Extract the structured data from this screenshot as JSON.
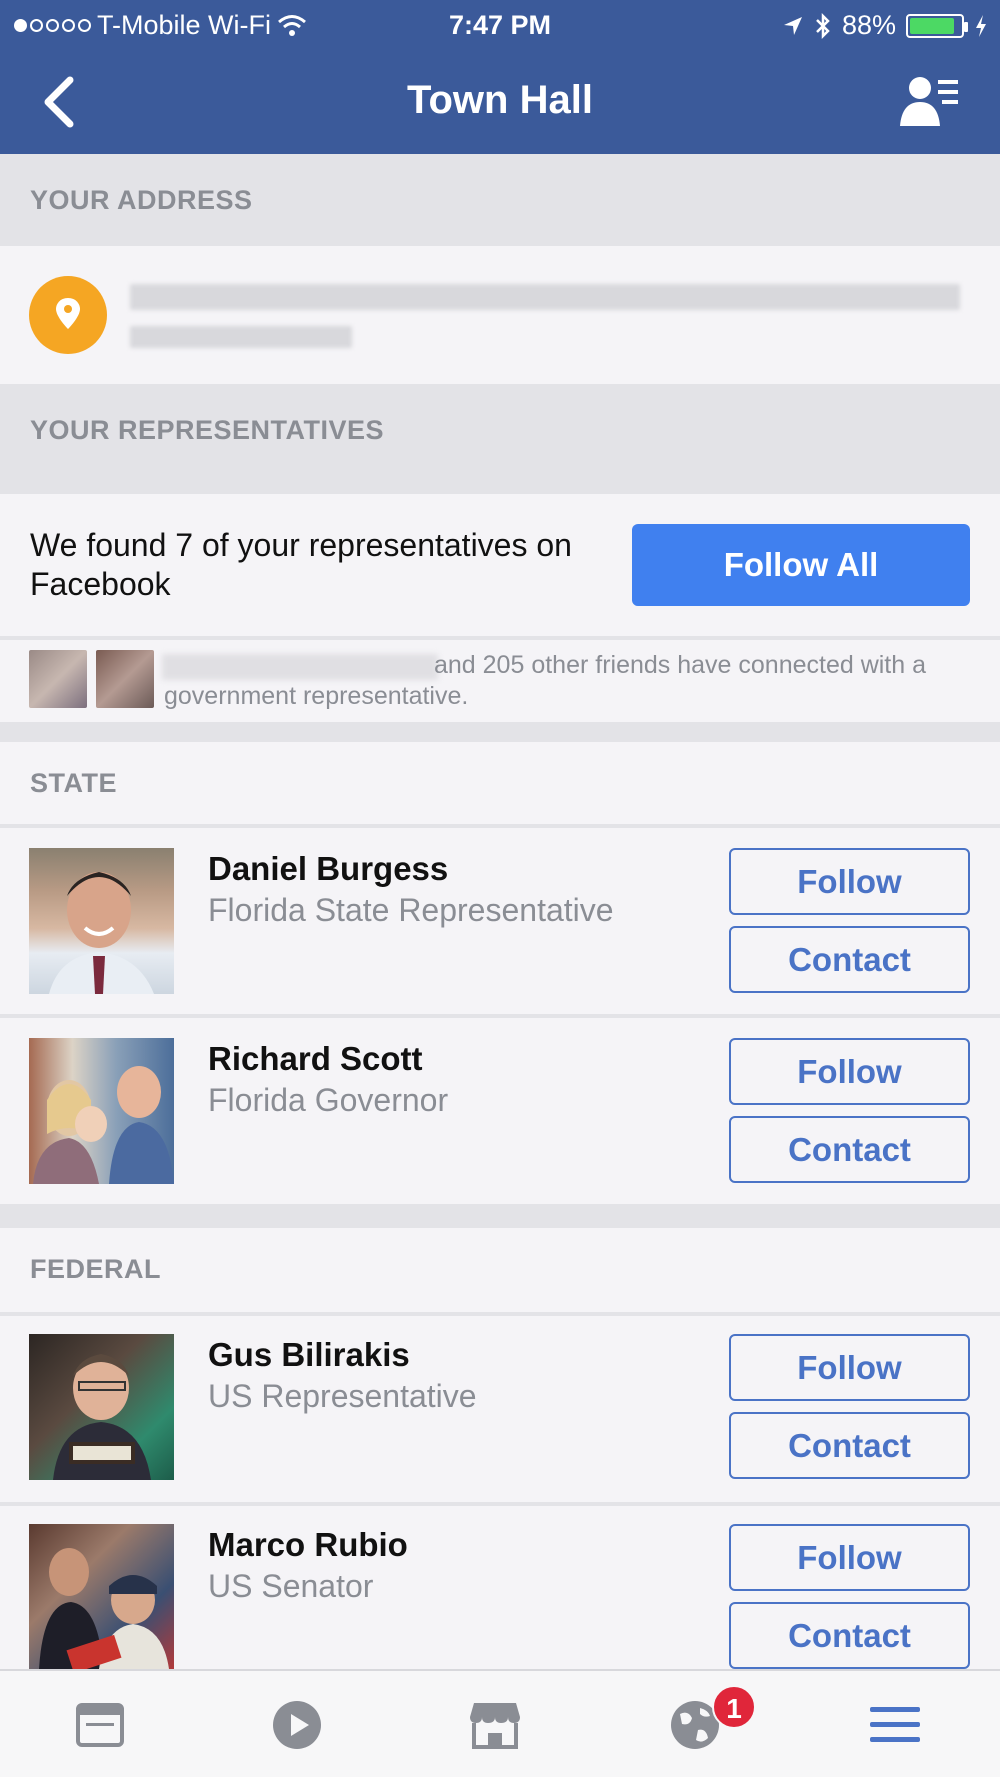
{
  "status_bar": {
    "carrier": "T-Mobile Wi-Fi",
    "time": "7:47 PM",
    "battery_percent": "88%",
    "battery_level": 0.88
  },
  "nav": {
    "title": "Town Hall",
    "back_icon": "chevron-left-icon",
    "right_icon": "person-list-icon"
  },
  "address_section": {
    "header": "YOUR ADDRESS",
    "icon": "location-pin-icon",
    "accent": "#f5a623"
  },
  "reps_section": {
    "header": "YOUR REPRESENTATIVES",
    "found_text": "We found 7 of your representatives on Facebook",
    "follow_all_label": "Follow All",
    "friends_text": "and 205 other friends have connected with a government representative."
  },
  "groups": [
    {
      "label": "STATE",
      "reps": [
        {
          "name": "Daniel Burgess",
          "role": "Florida State Representative",
          "follow_label": "Follow",
          "contact_label": "Contact"
        },
        {
          "name": "Richard Scott",
          "role": "Florida Governor",
          "follow_label": "Follow",
          "contact_label": "Contact"
        }
      ]
    },
    {
      "label": "FEDERAL",
      "reps": [
        {
          "name": "Gus Bilirakis",
          "role": "US Representative",
          "follow_label": "Follow",
          "contact_label": "Contact"
        },
        {
          "name": "Marco Rubio",
          "role": "US Senator",
          "follow_label": "Follow",
          "contact_label": "Contact"
        }
      ]
    }
  ],
  "tab_bar": {
    "tabs": [
      "news-feed-icon",
      "video-icon",
      "marketplace-icon",
      "notifications-globe-icon",
      "menu-icon"
    ],
    "notification_count": "1"
  },
  "colors": {
    "brand_blue": "#3b5a9a",
    "button_blue": "#4080ef",
    "outline_blue": "#4a73c6",
    "badge_red": "#e0263a"
  }
}
